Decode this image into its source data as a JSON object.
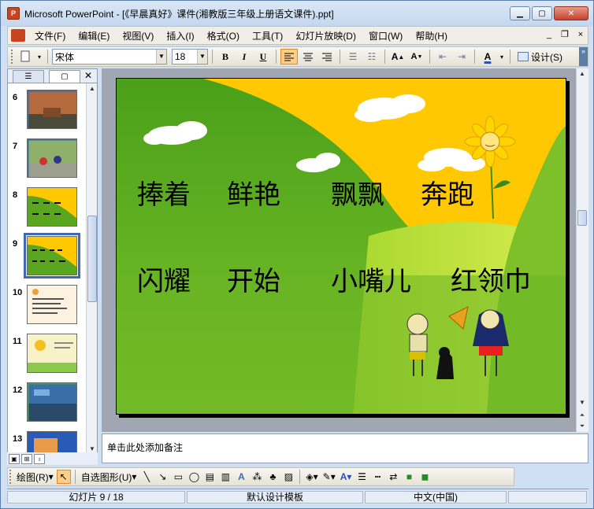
{
  "window": {
    "title": "Microsoft PowerPoint - [《早晨真好》课件(湘教版三年级上册语文课件).ppt]",
    "app_icon": "powerpoint-icon"
  },
  "menu": [
    "文件(F)",
    "编辑(E)",
    "视图(V)",
    "插入(I)",
    "格式(O)",
    "工具(T)",
    "幻灯片放映(D)",
    "窗口(W)",
    "帮助(H)"
  ],
  "toolbar": {
    "font": "宋体",
    "size": "18",
    "bold": "B",
    "italic": "I",
    "underline": "U",
    "design": "设计(S)"
  },
  "thumbnails": [
    {
      "num": "6"
    },
    {
      "num": "7"
    },
    {
      "num": "8"
    },
    {
      "num": "9",
      "selected": true
    },
    {
      "num": "10"
    },
    {
      "num": "11"
    },
    {
      "num": "12"
    },
    {
      "num": "13"
    }
  ],
  "slide": {
    "words": [
      "捧着",
      "鲜艳",
      "飘飘",
      "奔跑",
      "闪耀",
      "开始",
      "小嘴儿",
      "红领巾"
    ],
    "colors": {
      "green": "#5aa61e",
      "yellow": "#ffc800",
      "light_green": "#c8e838"
    }
  },
  "notes": {
    "placeholder": "单击此处添加备注"
  },
  "drawbar": {
    "draw": "绘图(R)",
    "autoshapes": "自选图形(U)"
  },
  "status": {
    "slide": "幻灯片 9 / 18",
    "template": "默认设计模板",
    "language": "中文(中国)"
  }
}
